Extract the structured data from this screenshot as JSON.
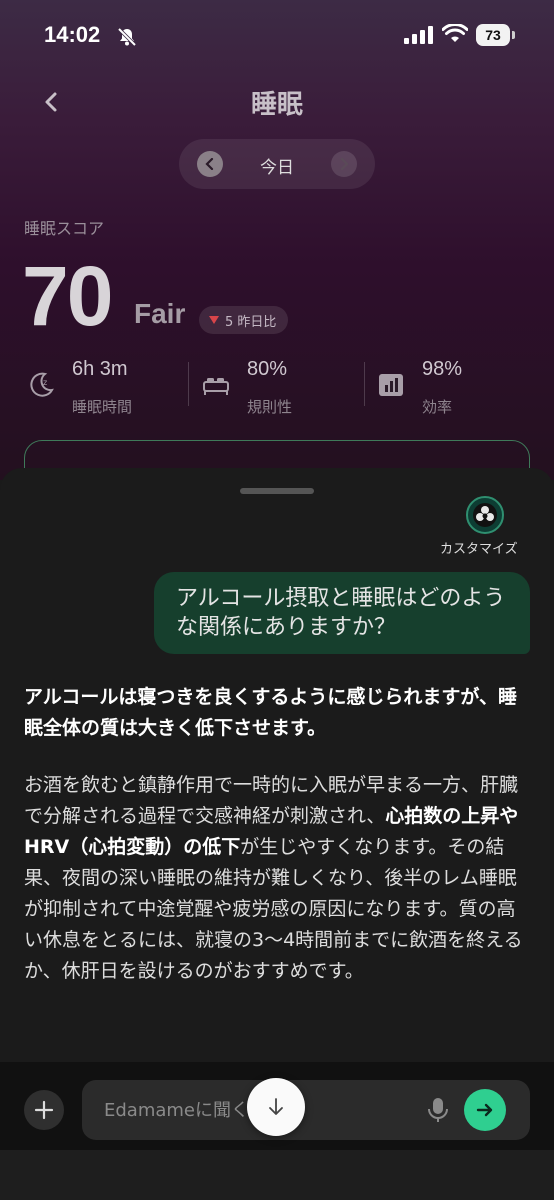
{
  "status_bar": {
    "time": "14:02",
    "battery": "73"
  },
  "header": {
    "title": "睡眠",
    "date_label": "今日"
  },
  "score": {
    "label": "睡眠スコア",
    "value": "70",
    "grade": "Fair",
    "delta_text": "5 昨日比",
    "delta_direction": "down"
  },
  "metrics": [
    {
      "value": "6h 3m",
      "label": "睡眠時間",
      "icon": "moon-icon"
    },
    {
      "value": "80%",
      "label": "規則性",
      "icon": "bed-icon"
    },
    {
      "value": "98%",
      "label": "効率",
      "icon": "efficiency-icon"
    }
  ],
  "chat": {
    "customize_label": "カスタマイズ",
    "user_message": "アルコール摂取と睡眠はどのような関係にありますか？",
    "ai_lead": "アルコールは寝つきを良くするように感じられますが、睡眠全体の質は大きく低下させます。",
    "ai_body_1": "お酒を飲むと鎮静作用で一時的に入眠が早まる一方、肝臓で分解される過程で交感神経が刺激され、",
    "ai_body_bold": "心拍数の上昇やHRV（心拍変動）の低下",
    "ai_body_2": "が生じやすくなります。その結果、夜間の深い睡眠の維持が難しくなり、後半のレム睡眠が抑制されて中途覚醒や疲労感の原因になります。質の高い休息をとるには、就寝の3〜4時間前までに飲酒を終えるか、休肝日を設けるのがおすすめです。",
    "input_placeholder": "Edamameに聞く"
  },
  "colors": {
    "accent": "#2fcf90",
    "user_bubble": "#163f2d",
    "delta_down": "#d8454a"
  }
}
